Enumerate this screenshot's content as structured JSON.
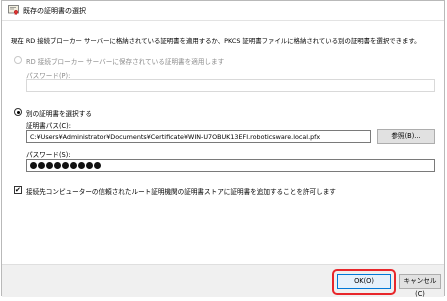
{
  "window": {
    "title": "既存の証明書の選択",
    "icon": "certificate-icon"
  },
  "intro": "現在 RD 接続ブローカー サーバーに格納されている証明書を適用するか、PKCS 証明書ファイルに格納されている別の証明書を選択できます。",
  "option_stored": {
    "label": "RD 接続ブローカー サーバーに保存されている証明書を適用します",
    "selected": false,
    "password_label": "パスワード(P):",
    "password_value": ""
  },
  "option_other": {
    "label": "別の証明書を選択する",
    "selected": true,
    "path_label": "証明書パス(C):",
    "path_value": "C:¥Users¥Administrator¥Documents¥Certificate¥WIN-U7OBUK13EFI.roboticsware.local.pfx",
    "browse_label": "参照(B)...",
    "password_label": "パスワード(S):",
    "password_masked_count": 9
  },
  "allow_checkbox": {
    "label": "接続先コンピューターの信頼されたルート証明機関の証明書ストアに証明書を追加することを許可します",
    "checked": true,
    "check_mark": "✔"
  },
  "footer": {
    "ok_label": "OK(O)",
    "cancel_label": "キャンセル(C)"
  },
  "colors": {
    "highlight": "#e8262a",
    "ok_border": "#0078d7"
  }
}
